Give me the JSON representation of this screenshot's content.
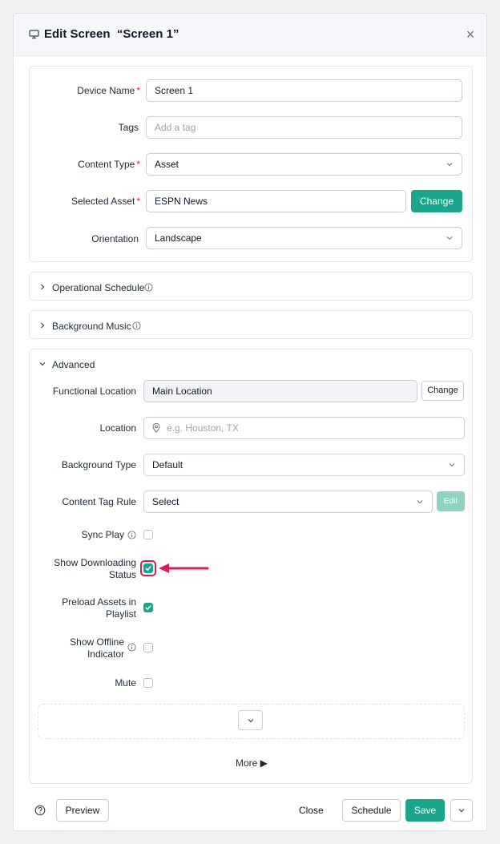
{
  "modal": {
    "title": "Edit Screen  “Screen 1”",
    "icon": "monitor-icon",
    "close_glyph": "×"
  },
  "basic": {
    "device_name_label": "Device Name",
    "device_name_value": "Screen 1",
    "tags_label": "Tags",
    "tags_placeholder": "Add a tag",
    "content_type_label": "Content Type",
    "content_type_value": "Asset",
    "selected_asset_label": "Selected Asset",
    "selected_asset_value": "ESPN News",
    "change_button": "Change",
    "orientation_label": "Orientation",
    "orientation_value": "Landscape",
    "required_mark": "*"
  },
  "sections": {
    "operational_schedule": "Operational Schedule",
    "background_music": "Background Music",
    "advanced": "Advanced"
  },
  "advanced": {
    "functional_location_label": "Functional Location",
    "functional_location_value": "Main Location",
    "functional_location_change": "Change",
    "location_label": "Location",
    "location_placeholder": "e.g. Houston, TX",
    "background_type_label": "Background Type",
    "background_type_value": "Default",
    "content_tag_rule_label": "Content Tag Rule",
    "content_tag_rule_value": "Select",
    "edit_button": "Edit",
    "sync_play_label": "Sync Play",
    "sync_play_checked": false,
    "show_downloading_label_1": "Show Downloading",
    "show_downloading_label_2": "Status",
    "show_downloading_checked": true,
    "preload_assets_label_1": "Preload Assets in",
    "preload_assets_label_2": "Playlist",
    "preload_assets_checked": true,
    "show_offline_label_1": "Show Offline",
    "show_offline_label_2": "Indicator",
    "show_offline_checked": false,
    "mute_label": "Mute",
    "mute_checked": false,
    "more_link": "More ▶"
  },
  "footer": {
    "help_icon": "help-circle-icon",
    "preview": "Preview",
    "close": "Close",
    "schedule": "Schedule",
    "save": "Save"
  },
  "colors": {
    "accent": "#1aa68b",
    "required": "#e11d48",
    "highlight": "#d61f4f"
  }
}
